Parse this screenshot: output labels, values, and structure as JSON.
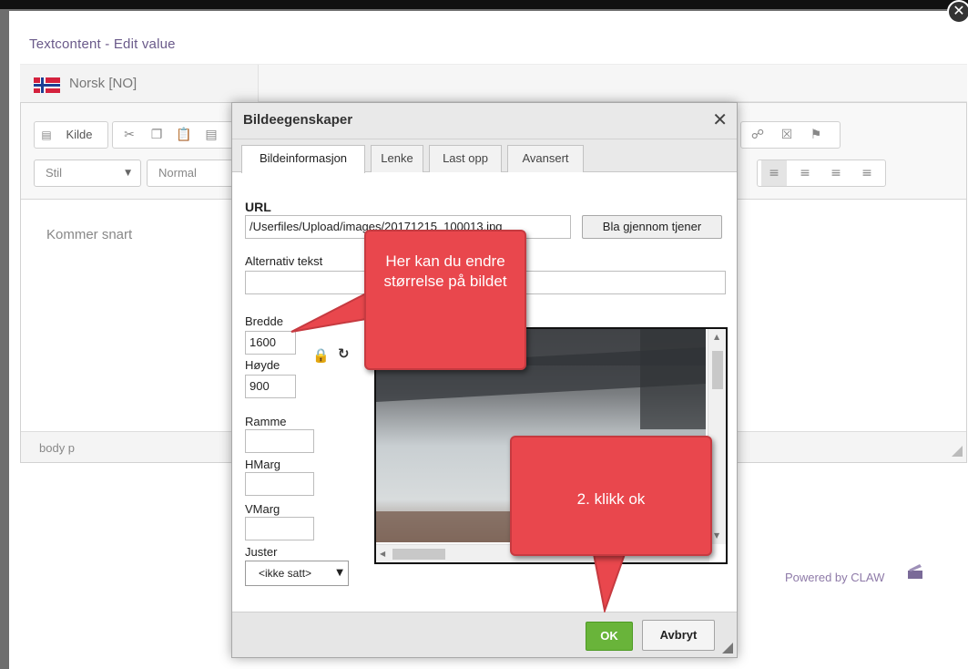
{
  "panel": {
    "title": "Textcontent - Edit value",
    "language_label": "Norsk [NO]",
    "powered_by": "Powered by CLAW"
  },
  "colors": {
    "accent_purple": "#6a5a8a",
    "ok_green": "#69b43a",
    "callout_red": "#e9474d",
    "flag_red": "#d4213d",
    "flag_blue": "#1c3f94"
  },
  "toolbar": {
    "source_label": "Kilde",
    "style_combo": "Stil",
    "format_combo": "Normal",
    "icons": [
      "cut-icon",
      "copy-icon",
      "paste-icon",
      "paste-text-icon",
      "link-icon",
      "unlink-icon",
      "anchor-flag-icon",
      "align-left-icon",
      "align-center-icon",
      "align-right-icon",
      "align-justify-icon"
    ]
  },
  "editor": {
    "content_text": "Kommer snart",
    "status_path": "body  p"
  },
  "dialog": {
    "title": "Bildeegenskaper",
    "tabs": [
      {
        "label": "Bildeinformasjon",
        "active": true
      },
      {
        "label": "Lenke",
        "active": false
      },
      {
        "label": "Last opp",
        "active": false
      },
      {
        "label": "Avansert",
        "active": false
      }
    ],
    "url_label": "URL",
    "url_value": "/Userfiles/Upload/images/20171215_100013.jpg",
    "browse_label": "Bla gjennom tjener",
    "alt_label": "Alternativ tekst",
    "alt_value": "",
    "width_label": "Bredde",
    "width_value": "1600",
    "height_label": "Høyde",
    "height_value": "900",
    "border_label": "Ramme",
    "border_value": "",
    "hspace_label": "HMarg",
    "hspace_value": "",
    "vspace_label": "VMarg",
    "vspace_value": "",
    "align_label": "Juster",
    "align_value": "<ikke satt>",
    "ok_label": "OK",
    "cancel_label": "Avbryt"
  },
  "callouts": {
    "resize_hint": "Her kan du endre størrelse på bildet",
    "ok_hint": "2. klikk ok"
  }
}
